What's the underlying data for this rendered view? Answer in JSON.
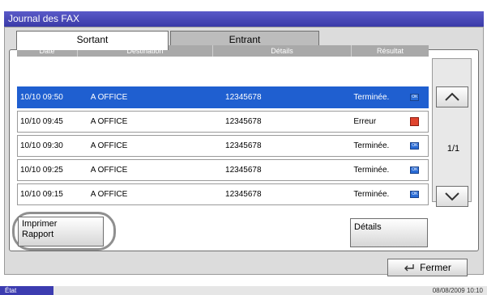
{
  "window": {
    "title": "Journal des FAX"
  },
  "tabs": [
    {
      "label": "Sortant"
    },
    {
      "label": "Entrant"
    }
  ],
  "table": {
    "headers": {
      "date": "Date",
      "destination": "Destination",
      "details": "Détails",
      "result": "Résultat"
    },
    "rows": [
      {
        "date": "10/10 09:50",
        "destination": "A OFFICE",
        "details": "12345678",
        "result": "Terminée.",
        "icon": "fax-ok-icon"
      },
      {
        "date": "10/10 09:45",
        "destination": "A OFFICE",
        "details": "12345678",
        "result": "Erreur",
        "icon": "fax-error-icon"
      },
      {
        "date": "10/10 09:30",
        "destination": "A OFFICE",
        "details": "12345678",
        "result": "Terminée.",
        "icon": "fax-ok-icon"
      },
      {
        "date": "10/10 09:25",
        "destination": "A OFFICE",
        "details": "12345678",
        "result": "Terminée.",
        "icon": "fax-ok-icon"
      },
      {
        "date": "10/10 09:15",
        "destination": "A OFFICE",
        "details": "12345678",
        "result": "Terminée.",
        "icon": "fax-ok-icon"
      }
    ]
  },
  "pagination": {
    "indicator": "1/1"
  },
  "buttons": {
    "imprimer_line1": "Imprimer",
    "imprimer_line2": "Rapport",
    "details": "Détails",
    "fermer": "Fermer"
  },
  "status": {
    "left": "État",
    "datetime": "08/08/2009   10:10"
  },
  "colors": {
    "accent": "#1f5fd0",
    "title_bar": "#3a3aa8",
    "error": "#e0442e"
  }
}
